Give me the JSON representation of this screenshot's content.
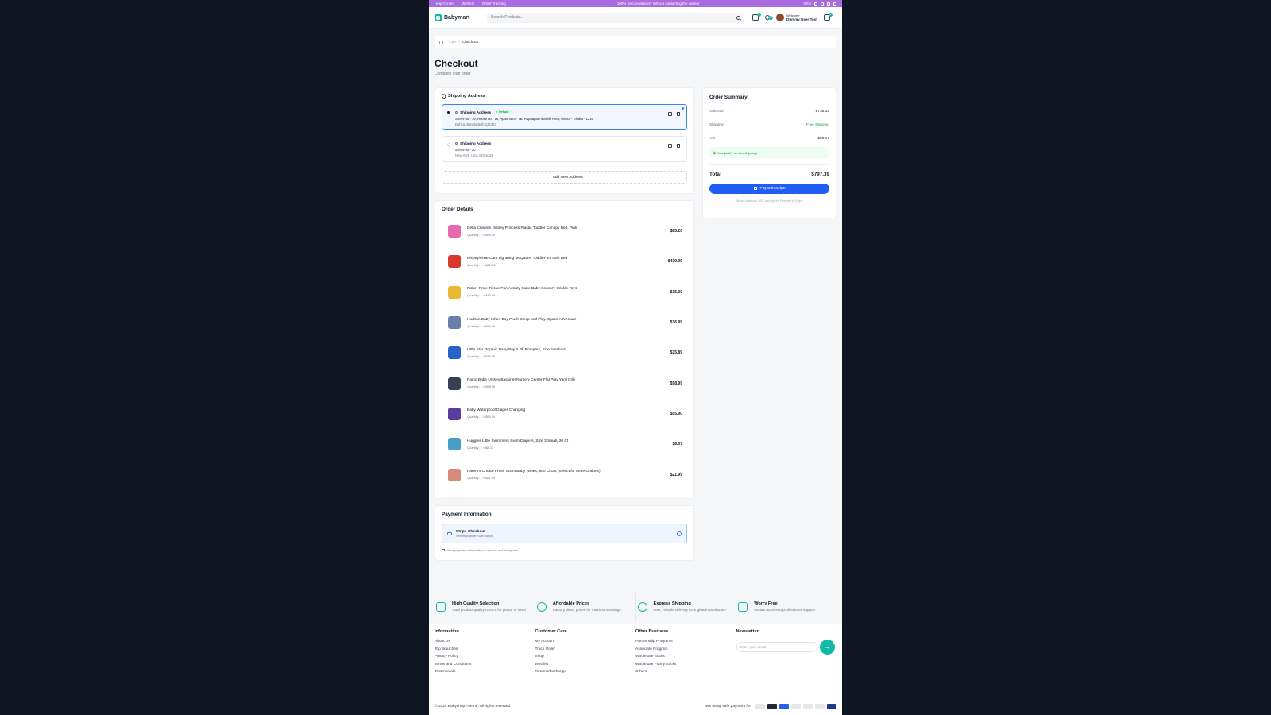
{
  "topbar": {
    "links": [
      "Help Center",
      "Wishlist",
      "Order Tracking"
    ],
    "notice": "100% Secure delivery without contacting the courier",
    "currency": "USD"
  },
  "header": {
    "brand": "Babymart",
    "search_placeholder": "Search Products...",
    "cart_count": "0",
    "wishlist_count": "0",
    "orders_count": "0",
    "welcome": "Welcome",
    "user_name": "Dummy User Test"
  },
  "breadcrumb": {
    "parent": "Cart",
    "current": "Checkout",
    "sep": "/"
  },
  "page": {
    "title": "Checkout",
    "subtitle": "Complete your order"
  },
  "shipping": {
    "title": "Shipping Address",
    "addresses": [
      {
        "label": "Shipping Address",
        "badge": "✓ Default",
        "line1": "Street-no - 19, House no - 16, Apartment - 7B, Rupnagar Abashik Area, Mirpur - Dhaka - 1216",
        "line2": "Dahka, Bangladesh 122323"
      },
      {
        "label": "Shipping Address",
        "line1": "Street-no - 20",
        "line2": "New York, USA 3232e328"
      }
    ],
    "add_label": "Add New Address"
  },
  "orders": {
    "title": "Order Details",
    "items": [
      {
        "name": "Delta Children Disney Princess Plastic Toddler Canopy Bed, Pink",
        "qty": "Quantity: 1 × $85.20",
        "price": "$85.20",
        "color": "#e56ab0"
      },
      {
        "name": "Disney/Pixar Cars Lightning McQueen Toddler-To-Twin Bed",
        "qty": "Quantity: 1 × $419.99",
        "price": "$419.99",
        "color": "#d73b2f"
      },
      {
        "name": "Fisher-Price Tissue Fun Activity Cube Baby Sensory Crinkle Toys",
        "qty": "Quantity: 1 × $15.00",
        "price": "$15.00",
        "color": "#e8b832"
      },
      {
        "name": "Hudson Baby Infant Boy Plush Sleep and Play, Space Adventure",
        "qty": "Quantity: 1 × $16.99",
        "price": "$16.99",
        "color": "#6b7fa8"
      },
      {
        "name": "Little Star Organic Baby Boy 2 Pk Rompers, Size Newborn",
        "qty": "Quantity: 1 × $15.89",
        "price": "$15.89",
        "color": "#2563c9"
      },
      {
        "name": "Pamo Babe Unisex Bassinet Nursery Center Flat Play Yard Crib",
        "qty": "Quantity: 1 × $98.99",
        "price": "$98.99",
        "color": "#374151"
      },
      {
        "name": "Baby Waterproof Diaper Changing",
        "qty": "Quantity: 1 × $55.90",
        "price": "$55.90",
        "color": "#5b3d9e"
      },
      {
        "name": "Huggies Little Swimmers Swim Diapers, Size 3 Small, 20 Ct",
        "qty": "Quantity: 1 × $8.37",
        "price": "$8.37",
        "color": "#4a9ec5"
      },
      {
        "name": "Parent's Choice Fresh Scent Baby Wipes, 900 Count (Select for More Options)",
        "qty": "Quantity: 1 × $21.99",
        "price": "$21.99",
        "color": "#d68a7a"
      }
    ]
  },
  "payment": {
    "title": "Payment Information",
    "method": "Stripe Checkout",
    "method_sub": "Secure payment with Stripe",
    "note": "Your payment information is secure and encrypted"
  },
  "summary": {
    "title": "Order Summary",
    "subtotal_label": "Subtotal",
    "subtotal": "$738.32",
    "shipping_label": "Shipping",
    "shipping": "Free shipping",
    "tax_label": "Tax",
    "tax": "$59.07",
    "qualify": "🎉 You qualify for free shipping!",
    "total_label": "Total",
    "total": "$797.39",
    "pay_label": "Pay with Stripe",
    "secure": "Secure checkout • SSL encrypted • Powered by Stripe"
  },
  "features": [
    {
      "title": "High Quality Selection",
      "desc": "Total product quality control for peace of mind"
    },
    {
      "title": "Affordable Prices",
      "desc": "Factory direct prices for maximum savings"
    },
    {
      "title": "Express Shipping",
      "desc": "Fast, reliable delivery from global warehouse"
    },
    {
      "title": "Worry Free",
      "desc": "Instant access to professional support"
    }
  ],
  "footer": {
    "information": {
      "title": "Information",
      "links": [
        "About Us",
        "Top Searches",
        "Privacy Policy",
        "Terms and Conditions",
        "Testimonials"
      ]
    },
    "care": {
      "title": "Customer Care",
      "links": [
        "My Account",
        "Track Order",
        "Shop",
        "Wishlist",
        "Returns/Exchange"
      ]
    },
    "business": {
      "title": "Other Business",
      "links": [
        "Partnership Programs",
        "Associate Program",
        "Wholesale Socks",
        "Wholesale Funny Socks",
        "Others"
      ]
    },
    "newsletter": {
      "title": "Newsletter",
      "placeholder": "Enter your email"
    },
    "copyright": "© 2024 Babyshop Theme. All rights reserved.",
    "payments_label": "We using safe payment for"
  },
  "colors": {
    "accent": "#14b8a6",
    "primary": "#1e5ef5",
    "topbar": "#a86be0"
  }
}
